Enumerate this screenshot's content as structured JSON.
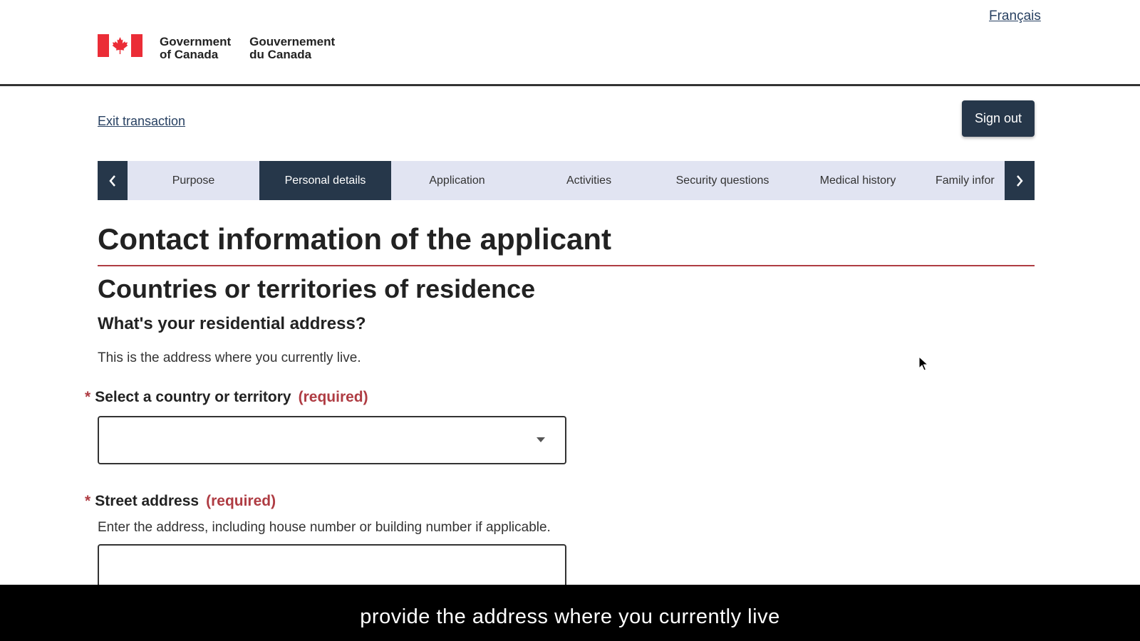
{
  "header": {
    "language_link": "Français",
    "brand_en_line1": "Government",
    "brand_en_line2": "of Canada",
    "brand_fr_line1": "Gouvernement",
    "brand_fr_line2": "du Canada"
  },
  "toolbar": {
    "exit_label": "Exit transaction",
    "signout_label": "Sign out"
  },
  "stepper": {
    "steps": [
      {
        "label": "Purpose"
      },
      {
        "label": "Personal details",
        "active": true
      },
      {
        "label": "Application"
      },
      {
        "label": "Activities"
      },
      {
        "label": "Security questions"
      },
      {
        "label": "Medical history"
      },
      {
        "label": "Family infor"
      }
    ]
  },
  "main": {
    "title": "Contact information of the applicant",
    "section_title": "Countries or territories of residence",
    "question": "What's your residential address?",
    "helper": "This is the address where you currently live.",
    "country_field": {
      "asterisk": "*",
      "label": "Select a country or territory",
      "required": "(required)",
      "value": ""
    },
    "street_field": {
      "asterisk": "*",
      "label": "Street address",
      "required": "(required)",
      "hint": "Enter the address, including house number or building number if applicable.",
      "value": ""
    }
  },
  "caption": {
    "text": "provide the address where you currently live"
  },
  "colors": {
    "primary": "#26374a",
    "link": "#284162",
    "required": "#af3c43",
    "stepper_bg": "#e1e4f2",
    "flag_red": "#eb2d37"
  }
}
